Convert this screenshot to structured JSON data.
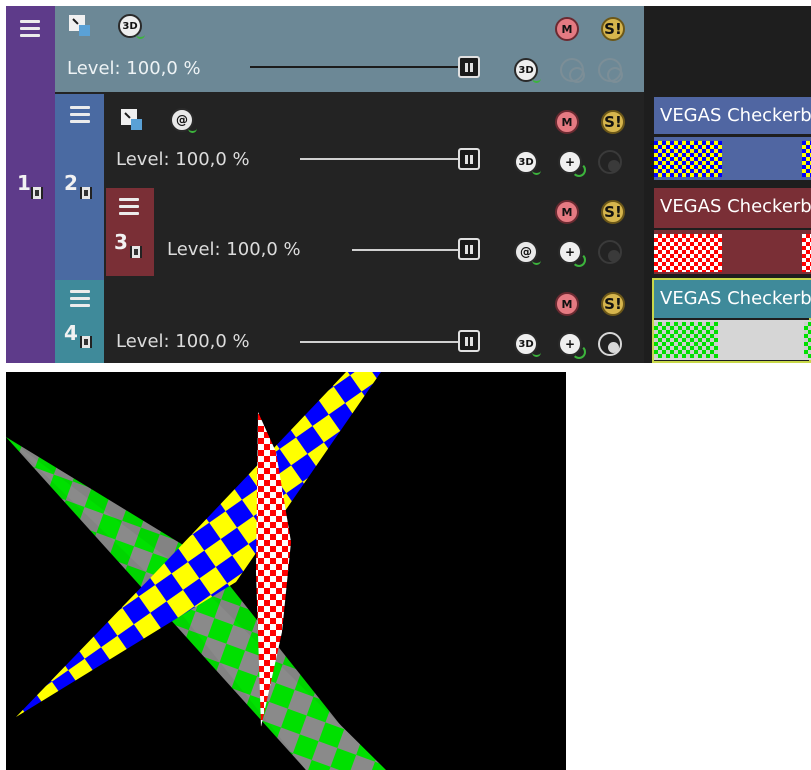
{
  "tracks": [
    {
      "number": "1",
      "level": "Level: 100,0 %",
      "level_value": 1.0
    },
    {
      "number": "2",
      "level": "Level: 100,0 %",
      "level_value": 1.0
    },
    {
      "number": "3",
      "level": "Level: 100,0 %",
      "level_value": 1.0
    },
    {
      "number": "4",
      "level": "Level: 100,0 %",
      "level_value": 1.0
    }
  ],
  "icons": {
    "mute": "M",
    "solo": "S!",
    "three_d": "3D",
    "at": "@",
    "plus": "+"
  },
  "events": [
    {
      "title": "VEGAS Checkerb",
      "header_color": "#5066a2",
      "color_a": "#ffff00",
      "color_b": "#0000ff",
      "bar_color": "#5066a2"
    },
    {
      "title": "VEGAS Checkerb",
      "header_color": "#7a2f36",
      "color_a": "#ff0000",
      "color_b": "#ffffff",
      "bar_color": "#7a2f36"
    },
    {
      "title": "VEGAS Checkerb",
      "header_color": "#3f8a9a",
      "color_a": "#00e000",
      "color_b": "#cfcfcf",
      "bar_color": "#d6d6d6"
    }
  ],
  "colors": {
    "track1_strip": "#5e3b8a",
    "track1_header": "#6c8896",
    "track2_strip": "#4a6aa2",
    "track3_strip": "#7a2f36",
    "track4_strip": "#3f8a9a",
    "preview_background": "#000000"
  }
}
